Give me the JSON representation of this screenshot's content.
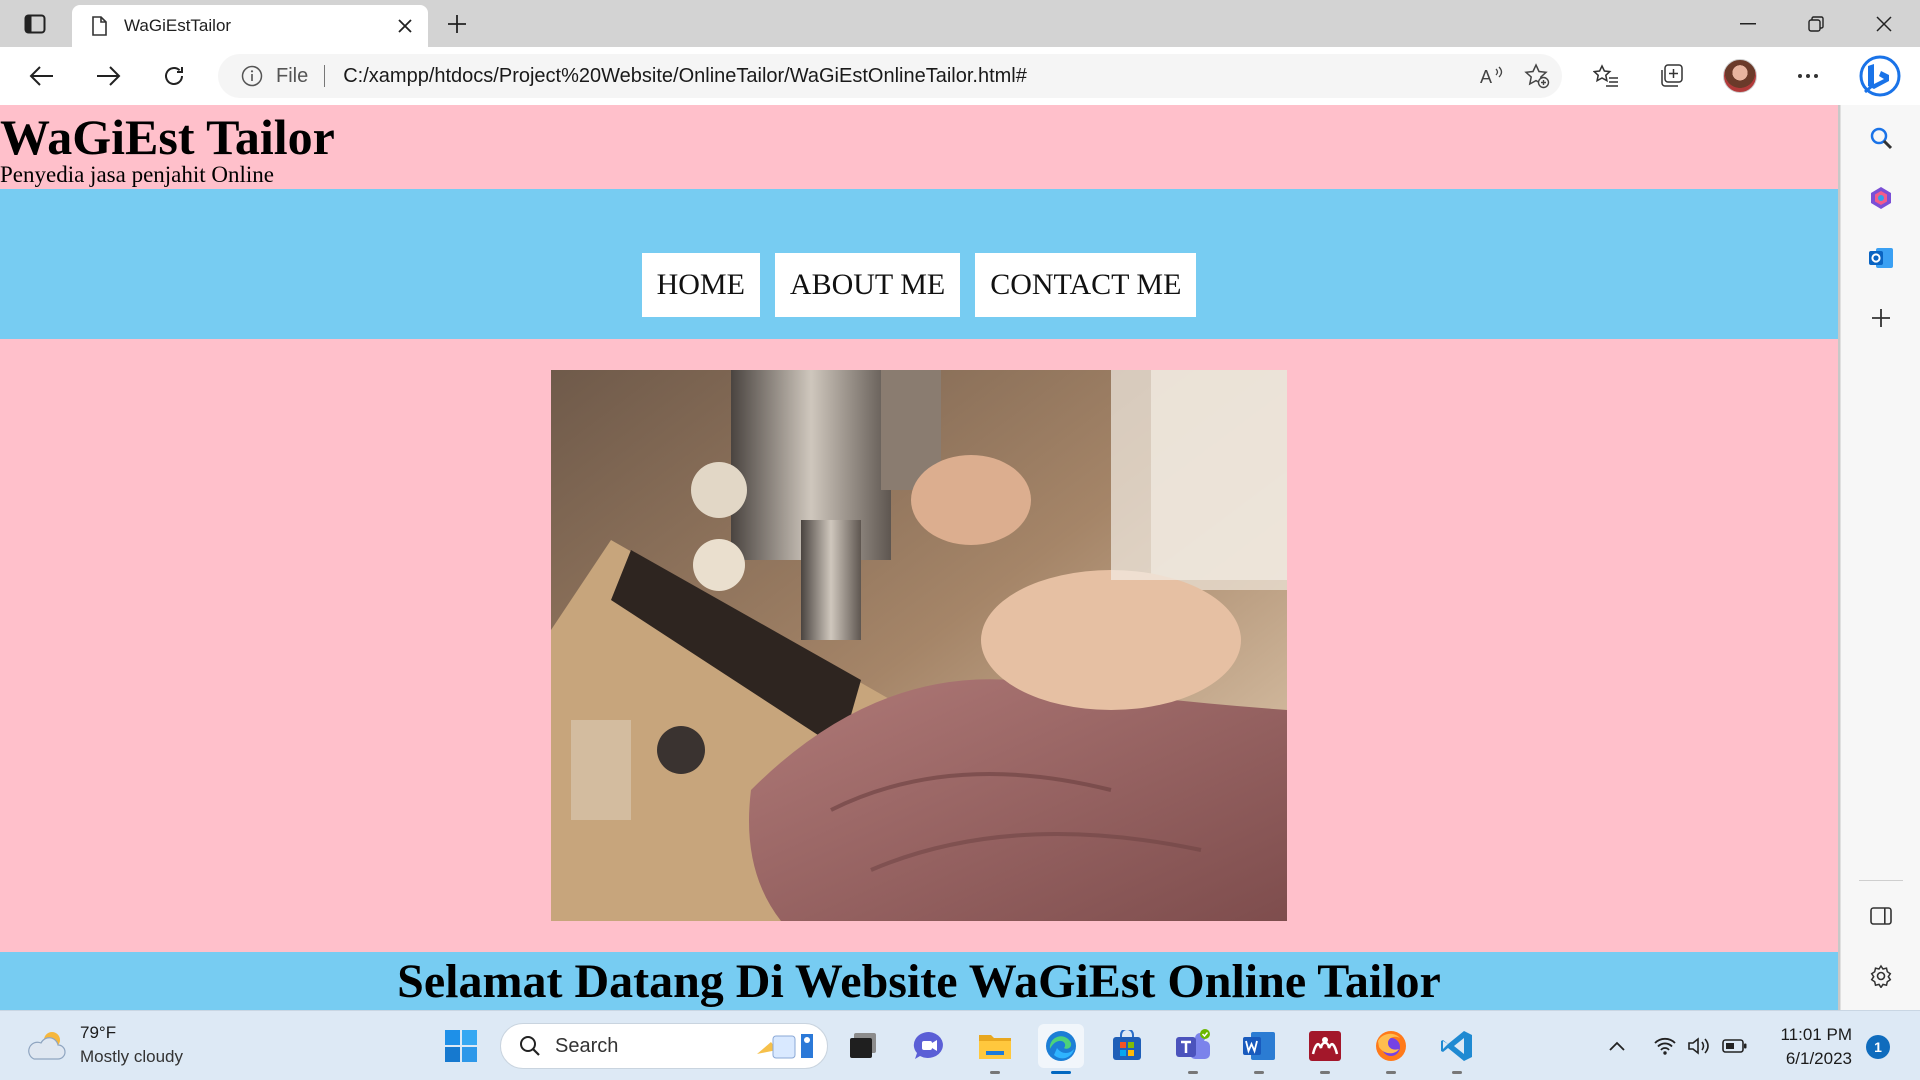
{
  "browser": {
    "tab_title": "WaGiEstTailor",
    "address_scheme_label": "File",
    "url": "C:/xampp/htdocs/Project%20Website/OnlineTailor/WaGiEstOnlineTailor.html#"
  },
  "page": {
    "site_title": "WaGiEst Tailor",
    "site_subtitle": "Penyedia jasa penjahit Online",
    "nav": [
      {
        "label": "HOME"
      },
      {
        "label": "ABOUT ME"
      },
      {
        "label": "CONTACT ME"
      }
    ],
    "welcome_heading": "Selamat Datang Di Website WaGiEst Online Tailor",
    "colors": {
      "background": "#ffc0cb",
      "band": "#77ccf2",
      "nav_item_bg": "#ffffff"
    }
  },
  "taskbar": {
    "weather_temp": "79°F",
    "weather_condition": "Mostly cloudy",
    "search_label": "Search",
    "clock_time": "11:01 PM",
    "clock_date": "6/1/2023",
    "notification_count": "1",
    "pinned_apps": [
      "start-icon",
      "task-view-icon",
      "chat-icon",
      "file-explorer-icon",
      "edge-icon",
      "store-icon",
      "teams-icon",
      "word-icon",
      "mendeley-icon",
      "firefox-icon",
      "vscode-icon"
    ]
  }
}
